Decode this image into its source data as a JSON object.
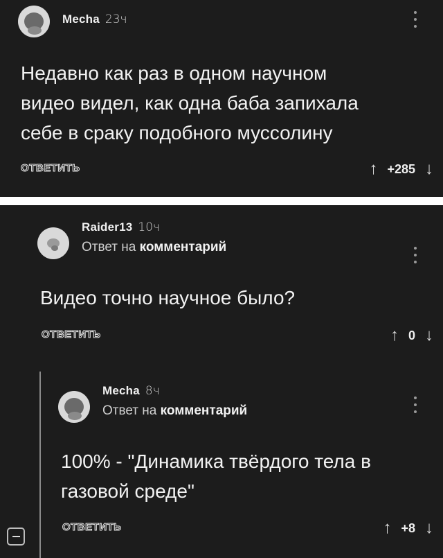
{
  "comments": [
    {
      "author": "Mecha",
      "time": "23ч",
      "text_lines": [
        "Недавно как раз в одном научном",
        "видео видел, как одна баба запихала",
        "себе в сраку подобного муссолину"
      ],
      "reply_label": "ОТВЕТИТЬ",
      "score": "+285"
    },
    {
      "author": "Raider13",
      "time": "10ч",
      "reply_prefix": "Ответ на",
      "reply_target": "комментарий",
      "text_lines": [
        "Видео точно научное было?"
      ],
      "reply_label": "ОТВЕТИТЬ",
      "score": "0"
    },
    {
      "author": "Mecha",
      "time": "8ч",
      "reply_prefix": "Ответ на",
      "reply_target": "комментарий",
      "text_lines": [
        "100% - \"Динамика твёрдого тела в",
        "газовой среде\""
      ],
      "reply_label": "ОТВЕТИТЬ",
      "score": "+8"
    }
  ],
  "icons": {
    "upvote": "arrow-up-icon",
    "downvote": "arrow-down-icon",
    "more": "vertical-dots-icon",
    "collapse": "minus-square-icon"
  },
  "colors": {
    "background": "#1c1c1c",
    "text": "#f2f2f2",
    "separator": "#ffffff"
  }
}
